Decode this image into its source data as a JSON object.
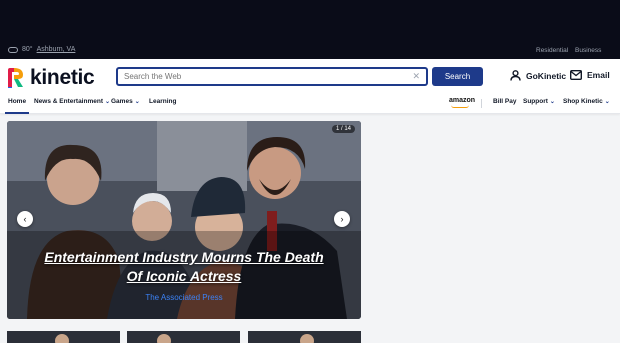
{
  "weather": {
    "temp": "80°",
    "location": "Ashburn, VA",
    "icon": "cloud-icon"
  },
  "segments": {
    "residential": "Residential",
    "business": "Business"
  },
  "brand": {
    "name": "kinetic",
    "colors": [
      "#e11d48",
      "#f59e0b",
      "#10b981",
      "#2563eb"
    ]
  },
  "search": {
    "placeholder": "Search the Web",
    "button": "Search",
    "clear_icon": "close-icon"
  },
  "account": {
    "gokinetic": "GoKinetic",
    "email": "Email"
  },
  "nav": {
    "home": "Home",
    "news": "News & Entertainment",
    "games": "Games",
    "learning": "Learning",
    "amazon": "amazon",
    "billpay": "Bill Pay",
    "support": "Support",
    "shop": "Shop Kinetic"
  },
  "hero": {
    "counter": "1 / 14",
    "headline": "Entertainment Industry Mourns The Death Of Iconic Actress",
    "source": "The Associated Press"
  },
  "colors": {
    "accent": "#1e3a8a",
    "link": "#3b82f6",
    "topband": "#0a0c18"
  }
}
